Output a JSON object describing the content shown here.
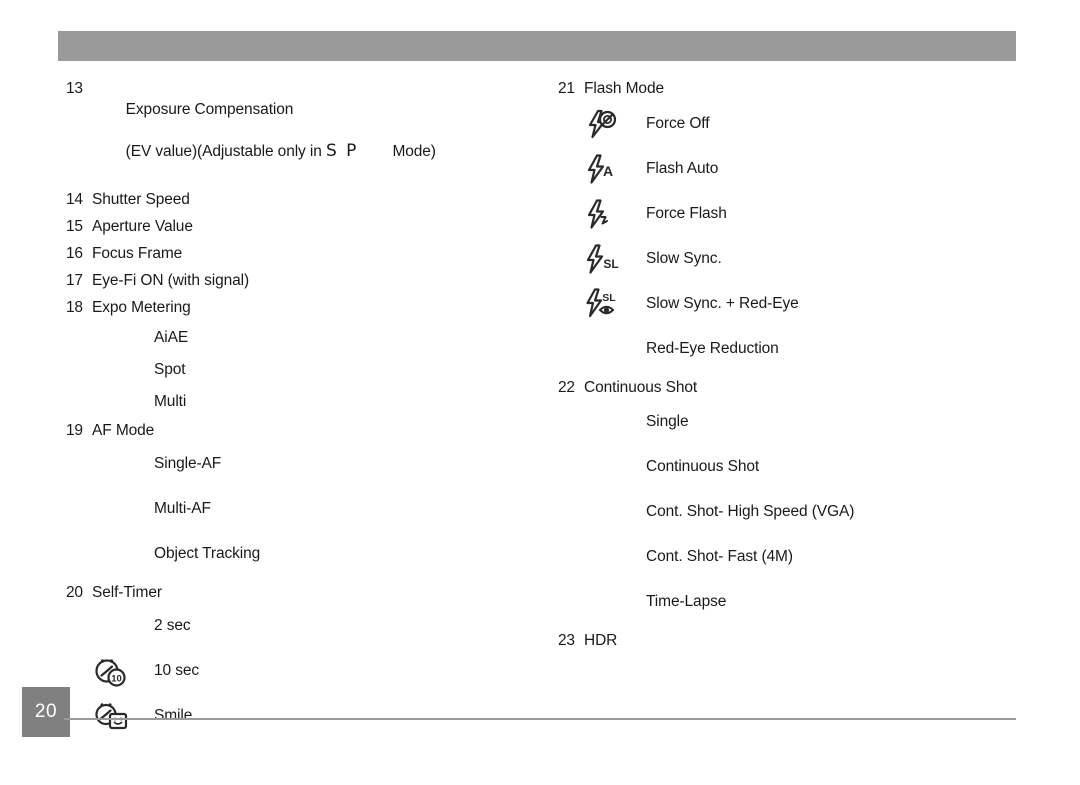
{
  "page": {
    "number": "20",
    "banner_color": "#9a9a9a",
    "badge_color": "#808080",
    "rule_color": "#9a9a9a"
  },
  "left_column": {
    "items": [
      {
        "num": "13",
        "label": "Exposure Compensation",
        "label_line2_a": "(EV value)(Adjustable only in ",
        "label_line2_modes": "S P",
        "label_line2_b": "Mode)"
      },
      {
        "num": "14",
        "label": "Shutter Speed"
      },
      {
        "num": "15",
        "label": "Aperture Value"
      },
      {
        "num": "16",
        "label": "Focus Frame"
      },
      {
        "num": "17",
        "label": "Eye-Fi ON (with signal)"
      },
      {
        "num": "18",
        "label": "Expo Metering"
      }
    ],
    "metering_options": [
      {
        "icon": "none",
        "label": "AiAE"
      },
      {
        "icon": "none",
        "label": "Spot"
      },
      {
        "icon": "none",
        "label": "Multi"
      }
    ],
    "af_mode": {
      "num": "19",
      "label": "AF Mode"
    },
    "af_options": [
      {
        "icon": "none",
        "label": "Single-AF"
      },
      {
        "icon": "none",
        "label": "Multi-AF"
      },
      {
        "icon": "none",
        "label": "Object Tracking"
      }
    ],
    "self_timer": {
      "num": "20",
      "label": "Self-Timer"
    },
    "self_timer_options": [
      {
        "icon": "none",
        "label": "2 sec"
      },
      {
        "icon": "timer-10sec-icon",
        "label": "10 sec"
      },
      {
        "icon": "timer-smile-icon",
        "label": "Smile"
      }
    ]
  },
  "right_column": {
    "flash_mode": {
      "num": "21",
      "label": "Flash Mode"
    },
    "flash_options": [
      {
        "icon": "flash-force-off-icon",
        "label": "Force Off"
      },
      {
        "icon": "flash-auto-icon",
        "label": "Flash Auto"
      },
      {
        "icon": "flash-force-flash-icon",
        "label": "Force Flash"
      },
      {
        "icon": "flash-slow-sync-icon",
        "label": "Slow Sync."
      },
      {
        "icon": "flash-slow-sync-red-eye-icon",
        "label": "Slow Sync. + Red-Eye"
      },
      {
        "icon": "none",
        "label": "Red-Eye Reduction"
      }
    ],
    "continuous_shot": {
      "num": "22",
      "label": "Continuous Shot"
    },
    "continuous_options": [
      {
        "icon": "none",
        "label": "Single"
      },
      {
        "icon": "none",
        "label": "Continuous Shot"
      },
      {
        "icon": "none",
        "label": "Cont. Shot- High Speed (VGA)"
      },
      {
        "icon": "none",
        "label": "Cont. Shot- Fast (4M)"
      },
      {
        "icon": "none",
        "label": "Time-Lapse"
      }
    ],
    "hdr": {
      "num": "23",
      "label": "HDR"
    }
  }
}
